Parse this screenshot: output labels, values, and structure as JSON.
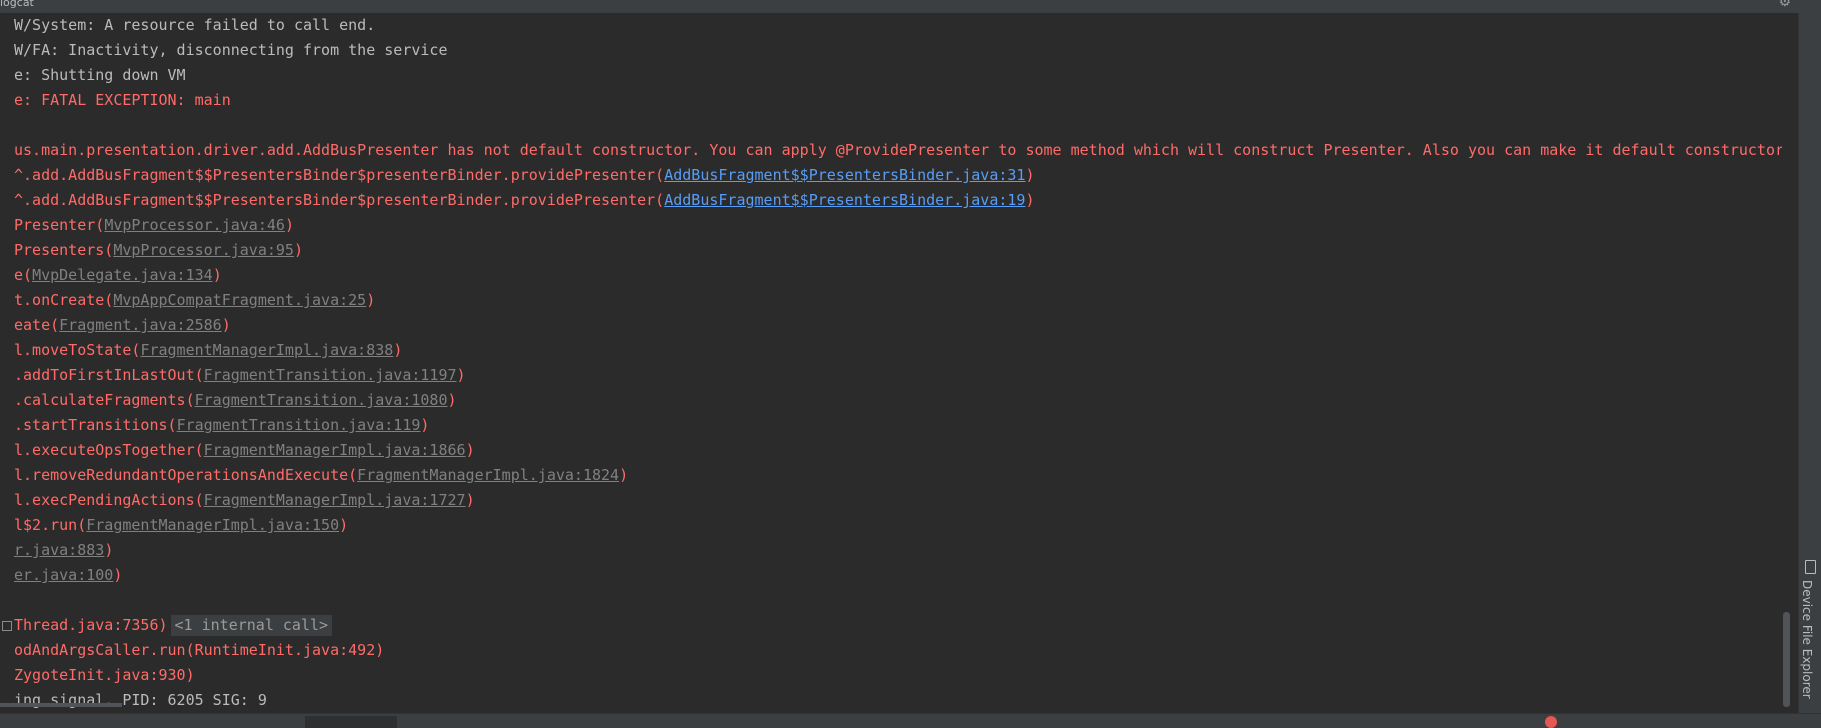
{
  "window": {
    "title": "logcat"
  },
  "log": {
    "lines": [
      {
        "text": "W/System: A resource failed to call end.",
        "level": "info"
      },
      {
        "text": "W/FA: Inactivity, disconnecting from the service",
        "level": "info"
      },
      {
        "text": "e: Shutting down VM",
        "level": "info"
      },
      {
        "text": "e: FATAL EXCEPTION: main",
        "level": "error"
      },
      {
        "text": "",
        "level": "info"
      },
      {
        "text": "us.main.presentation.driver.add.AddBusPresenter has not default constructor. You can apply @ProvidePresenter to some method which will construct Presenter. Also you can make it default constructor",
        "level": "error"
      },
      {
        "prefix": "^.add.AddBusFragment$$PresentersBinder$presenterBinder.providePresenter(",
        "link": "AddBusFragment$$PresentersBinder.java:31",
        "suffix": ")",
        "level": "error",
        "link_style": "blue"
      },
      {
        "prefix": "^.add.AddBusFragment$$PresentersBinder$presenterBinder.providePresenter(",
        "link": "AddBusFragment$$PresentersBinder.java:19",
        "suffix": ")",
        "level": "error",
        "link_style": "blue"
      },
      {
        "prefix": "Presenter(",
        "link": "MvpProcessor.java:46",
        "suffix": ")",
        "level": "error",
        "link_style": "gray"
      },
      {
        "prefix": "Presenters(",
        "link": "MvpProcessor.java:95",
        "suffix": ")",
        "level": "error",
        "link_style": "gray"
      },
      {
        "prefix": "e(",
        "link": "MvpDelegate.java:134",
        "suffix": ")",
        "level": "error",
        "link_style": "gray"
      },
      {
        "prefix": "t.onCreate(",
        "link": "MvpAppCompatFragment.java:25",
        "suffix": ")",
        "level": "error",
        "link_style": "gray"
      },
      {
        "prefix": "eate(",
        "link": "Fragment.java:2586",
        "suffix": ")",
        "level": "error",
        "link_style": "gray"
      },
      {
        "prefix": "l.moveToState(",
        "link": "FragmentManagerImpl.java:838",
        "suffix": ")",
        "level": "error",
        "link_style": "gray"
      },
      {
        "prefix": ".addToFirstInLastOut(",
        "link": "FragmentTransition.java:1197",
        "suffix": ")",
        "level": "error",
        "link_style": "gray"
      },
      {
        "prefix": ".calculateFragments(",
        "link": "FragmentTransition.java:1080",
        "suffix": ")",
        "level": "error",
        "link_style": "gray"
      },
      {
        "prefix": ".startTransitions(",
        "link": "FragmentTransition.java:119",
        "suffix": ")",
        "level": "error",
        "link_style": "gray"
      },
      {
        "prefix": "l.executeOpsTogether(",
        "link": "FragmentManagerImpl.java:1866",
        "suffix": ")",
        "level": "error",
        "link_style": "gray"
      },
      {
        "prefix": "l.removeRedundantOperationsAndExecute(",
        "link": "FragmentManagerImpl.java:1824",
        "suffix": ")",
        "level": "error",
        "link_style": "gray"
      },
      {
        "prefix": "l.execPendingActions(",
        "link": "FragmentManagerImpl.java:1727",
        "suffix": ")",
        "level": "error",
        "link_style": "gray"
      },
      {
        "prefix": "l$2.run(",
        "link": "FragmentManagerImpl.java:150",
        "suffix": ")",
        "level": "error",
        "link_style": "gray"
      },
      {
        "prefix": "",
        "link": "r.java:883",
        "suffix": ")",
        "level": "error",
        "link_style": "gray"
      },
      {
        "prefix": "",
        "link": "er.java:100",
        "suffix": ")",
        "level": "error",
        "link_style": "gray"
      },
      {
        "text": "",
        "level": "info"
      },
      {
        "text": "Thread.java:7356)",
        "level": "error",
        "gutter": true,
        "internal": "<1 internal call>"
      },
      {
        "text": "odAndArgsCaller.run(RuntimeInit.java:492)",
        "level": "error"
      },
      {
        "text": "ZygoteInit.java:930)",
        "level": "error"
      },
      {
        "text": "ing signal. PID: 6205 SIG: 9",
        "level": "info"
      }
    ]
  },
  "right_panel": {
    "tab_label": "Device File Explorer",
    "icon": "phone-icon"
  },
  "colors": {
    "background": "#2b2b2b",
    "error": "#ff6b68",
    "info": "#bbbbbb",
    "link": "#589df6",
    "link_muted": "#808080"
  }
}
